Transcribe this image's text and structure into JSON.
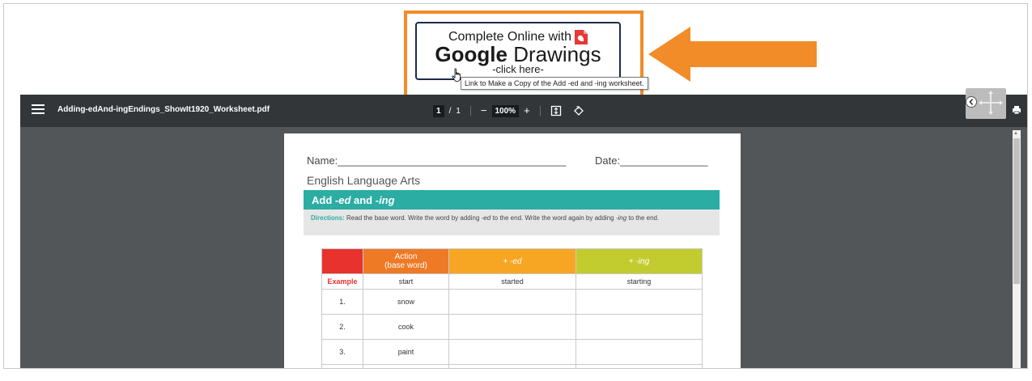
{
  "banner": {
    "line1": "Complete Online with",
    "line2_bold": "Google",
    "line2_rest": " Drawings",
    "line3": "-click here-",
    "tooltip": "Link to Make a Copy of the Add -ed and -ing worksheet.",
    "highlight_color": "#f28c28",
    "arrow_color": "#f28c28",
    "logo_icon": "google-drawings-icon"
  },
  "viewer": {
    "filename": "Adding-edAnd-ingEndings_ShowIt1920_Worksheet.pdf",
    "page_current": "1",
    "page_sep": "/",
    "page_total": "1",
    "zoom_out": "−",
    "zoom": "100%",
    "zoom_in": "+",
    "toolbar_bg": "#323639",
    "canvas_bg": "#525659"
  },
  "worksheet": {
    "name_label": "Name:_______________________________________",
    "date_label": "Date:_______________",
    "subject": "English Language Arts",
    "heading_prefix": "Add ",
    "heading_ed": "-ed",
    "heading_mid": " and ",
    "heading_ing": "-ing",
    "directions_label": "Directions:",
    "directions_text_1": " Read the base word. Write the word by adding ",
    "directions_ed": "-ed",
    "directions_text_2": " to the end. Write the word again by adding ",
    "directions_ing": "-ing",
    "directions_text_3": " to the end.",
    "table": {
      "col_action_1": "Action",
      "col_action_2": "(base word)",
      "col_ed_plus": "+ ",
      "col_ed": "-ed",
      "col_ing_plus": "+ ",
      "col_ing": "-ing",
      "example_label": "Example",
      "example_word": "start",
      "example_ed": "started",
      "example_ing": "starting",
      "rows": [
        {
          "num": "1.",
          "word": "snow"
        },
        {
          "num": "2.",
          "word": "cook"
        },
        {
          "num": "3.",
          "word": "paint"
        }
      ]
    }
  }
}
